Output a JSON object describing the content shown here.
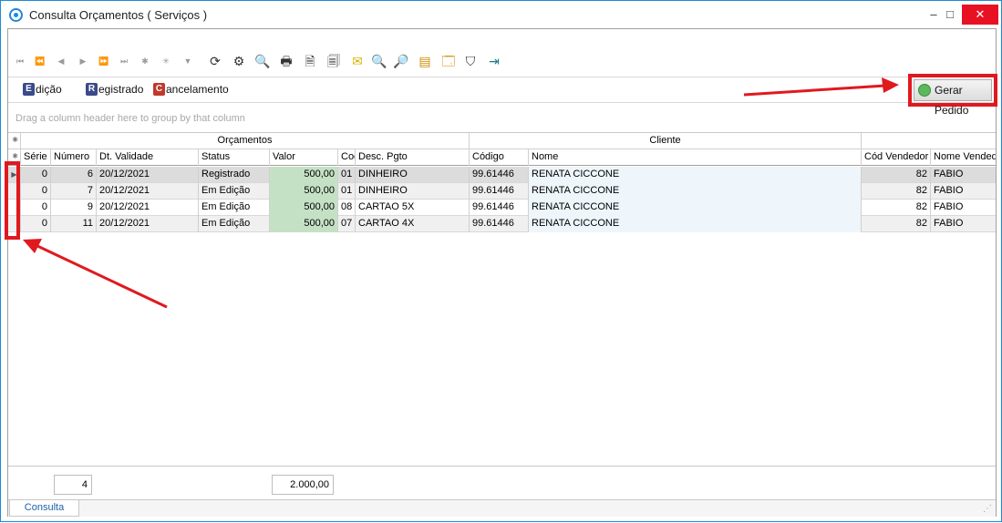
{
  "window": {
    "title": "Consulta Orçamentos ( Serviços )",
    "min": "–",
    "max": "□",
    "close": "✕"
  },
  "toolbar": {
    "nav": [
      "⏮",
      "⏪",
      "◀",
      "▶",
      "⏩",
      "⏭",
      "✱",
      "✳",
      "▼"
    ],
    "tools": [
      "⟳",
      "⚙",
      "🔍",
      "🖶",
      "🗎",
      "🗐",
      "✉",
      "🔍",
      "🔎",
      "▤",
      "🗔",
      "⛉",
      "⇥"
    ]
  },
  "options": {
    "edicao": {
      "badge": "E",
      "label": "dição",
      "color": "#3a4a8a"
    },
    "registrado": {
      "badge": "R",
      "label": "egistrado",
      "color": "#3a4a8a"
    },
    "cancelamento": {
      "badge": "C",
      "label": "ancelamento",
      "color": "#c0392b"
    }
  },
  "gerar_pedido": {
    "label": "Gerar Pedido"
  },
  "grid": {
    "group_hint": "Drag a column header here to group by that column",
    "bands": {
      "orcamentos": "Orçamentos",
      "cliente": "Cliente"
    },
    "headers": [
      "Série",
      "Número",
      "Dt. Validade",
      "Status",
      "Valor",
      "Coc",
      "Desc. Pgto",
      "Código",
      "Nome",
      "Cód Vendedor",
      "Nome Vendedo"
    ],
    "rows": [
      {
        "serie": "0",
        "numero": "6",
        "validade": "20/12/2021",
        "status": "Registrado",
        "valor": "500,00",
        "cod": "01",
        "desc": "DINHEIRO",
        "codigo": "99.61446",
        "nome": "RENATA CICCONE",
        "codvend": "82",
        "nomevend": "FABIO"
      },
      {
        "serie": "0",
        "numero": "7",
        "validade": "20/12/2021",
        "status": "Em Edição",
        "valor": "500,00",
        "cod": "01",
        "desc": "DINHEIRO",
        "codigo": "99.61446",
        "nome": "RENATA CICCONE",
        "codvend": "82",
        "nomevend": "FABIO"
      },
      {
        "serie": "0",
        "numero": "9",
        "validade": "20/12/2021",
        "status": "Em Edição",
        "valor": "500,00",
        "cod": "08",
        "desc": "CARTAO 5X",
        "codigo": "99.61446",
        "nome": "RENATA CICCONE",
        "codvend": "82",
        "nomevend": "FABIO"
      },
      {
        "serie": "0",
        "numero": "11",
        "validade": "20/12/2021",
        "status": "Em Edição",
        "valor": "500,00",
        "cod": "07",
        "desc": "CARTAO 4X",
        "codigo": "99.61446",
        "nome": "RENATA CICCONE",
        "codvend": "82",
        "nomevend": "FABIO"
      }
    ]
  },
  "footer": {
    "count": "4",
    "total": "2.000,00"
  },
  "tabs": {
    "consulta": "Consulta"
  },
  "colors": {
    "accent": "#1f8ad6",
    "annotation": "#e0191f",
    "valor_bg": "#c5e1c5"
  }
}
